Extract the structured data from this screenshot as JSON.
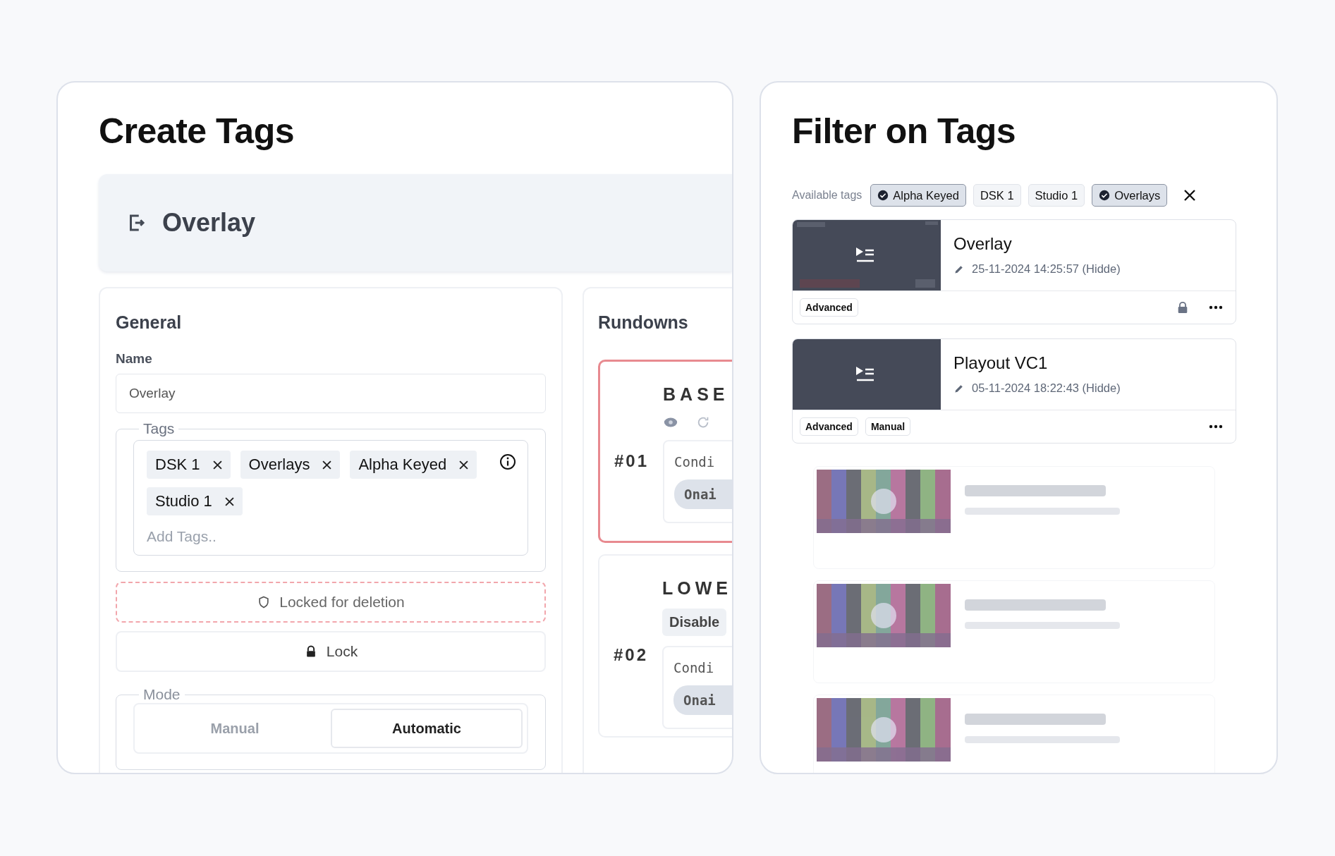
{
  "create_panel": {
    "title": "Create Tags",
    "header": {
      "title": "Overlay"
    },
    "general": {
      "heading": "General",
      "name_label": "Name",
      "name_value": "Overlay",
      "tags_legend": "Tags",
      "tags": [
        {
          "label": "DSK 1"
        },
        {
          "label": "Overlays"
        },
        {
          "label": "Alpha Keyed"
        },
        {
          "label": "Studio 1"
        }
      ],
      "tags_placeholder": "Add Tags..",
      "locked_button": "Locked for deletion",
      "lock_button": "Lock",
      "mode_legend": "Mode",
      "modes": [
        {
          "label": "Manual",
          "selected": false
        },
        {
          "label": "Automatic",
          "selected": true
        }
      ]
    },
    "rundowns": {
      "heading": "Rundowns",
      "items": [
        {
          "number": "#01",
          "title": "BASE",
          "highlighted": true,
          "condition": "Condi",
          "chip": "Onai"
        },
        {
          "number": "#02",
          "title": "LOWE",
          "highlighted": false,
          "status": "Disable",
          "condition": "Condi",
          "chip": "Onai"
        }
      ]
    }
  },
  "filter_panel": {
    "title": "Filter on Tags",
    "available_label": "Available tags",
    "tags": [
      {
        "label": "Alpha Keyed",
        "selected": true
      },
      {
        "label": "DSK 1",
        "selected": false
      },
      {
        "label": "Studio 1",
        "selected": false
      },
      {
        "label": "Overlays",
        "selected": true
      }
    ],
    "items": [
      {
        "title": "Overlay",
        "edited": "25-11-2024 14:25:57 (Hidde)",
        "kind": "preview",
        "badges": [
          "Advanced"
        ],
        "locked": true
      },
      {
        "title": "Playout VC1",
        "edited": "05-11-2024 18:22:43 (Hidde)",
        "kind": "plain",
        "badges": [
          "Advanced",
          "Manual"
        ],
        "locked": false
      }
    ]
  }
}
